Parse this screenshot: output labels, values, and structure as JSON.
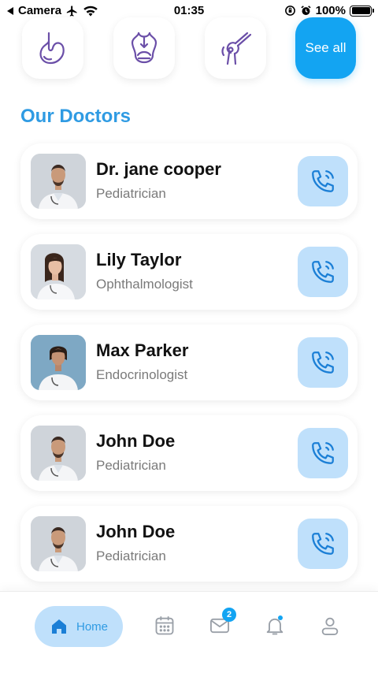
{
  "status_bar": {
    "back_label": "Camera",
    "time": "01:35",
    "battery_percent": "100%",
    "icons": [
      "back-arrow-icon",
      "airplane-icon",
      "wifi-icon",
      "orientation-lock-icon",
      "alarm-icon",
      "battery-icon"
    ]
  },
  "categories": {
    "items": [
      {
        "name": "stomach",
        "icon": "stomach-icon"
      },
      {
        "name": "lungs",
        "icon": "lungs-icon"
      },
      {
        "name": "knee",
        "icon": "knee-joint-icon"
      }
    ],
    "see_all_label": "See all"
  },
  "section_title": "Our Doctors",
  "doctors": [
    {
      "name": "Dr. jane cooper",
      "specialty": "Pediatrician"
    },
    {
      "name": "Lily Taylor",
      "specialty": "Ophthalmologist"
    },
    {
      "name": "Max Parker",
      "specialty": "Endocrinologist"
    },
    {
      "name": "John Doe",
      "specialty": "Pediatrician"
    },
    {
      "name": "John Doe",
      "specialty": "Pediatrician"
    }
  ],
  "bottom_nav": {
    "home_label": "Home",
    "messages_badge": "2",
    "items": [
      "home-icon",
      "calendar-icon",
      "mail-icon",
      "bell-icon",
      "profile-icon"
    ]
  },
  "colors": {
    "accent": "#13a4f2",
    "title_blue": "#2f9be3",
    "light_blue": "#bfe0fb",
    "icon_purple": "#6b4fa8"
  }
}
